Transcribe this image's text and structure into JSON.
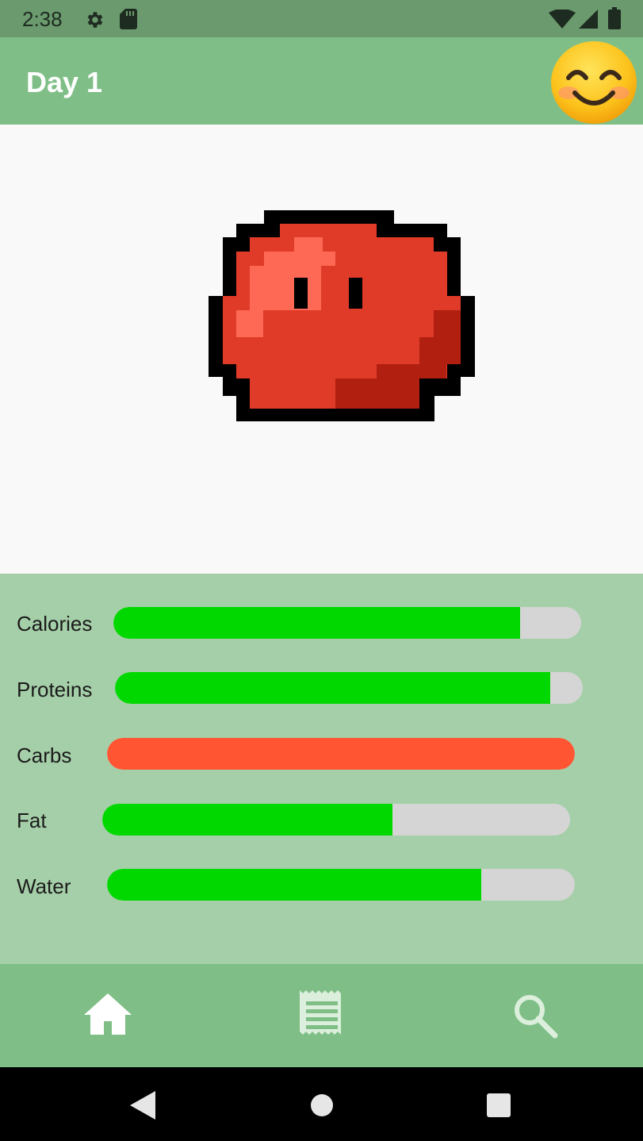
{
  "status_bar": {
    "time": "2:38",
    "icons": [
      "gear-icon",
      "sd-card-icon",
      "wifi-icon",
      "signal-icon",
      "battery-icon"
    ]
  },
  "app_bar": {
    "title": "Day 1",
    "mood_icon": "smiling-face-emoji-icon"
  },
  "pet": {
    "icon": "red-slime-pixel-icon",
    "colors": {
      "outline": "#000000",
      "body": "#e03a28",
      "highlight": "#fe6955",
      "shadow": "#b01f10"
    }
  },
  "stats": [
    {
      "label": "Calories",
      "fraction": 0.87,
      "color": "#00d800"
    },
    {
      "label": "Proteins",
      "fraction": 0.93,
      "color": "#00d800"
    },
    {
      "label": "Carbs",
      "fraction": 1.0,
      "color": "#ff5533"
    },
    {
      "label": "Fat",
      "fraction": 0.62,
      "color": "#00d800"
    },
    {
      "label": "Water",
      "fraction": 0.8,
      "color": "#00d800"
    }
  ],
  "bottom_nav": {
    "items": [
      {
        "icon": "home-icon",
        "selected": true
      },
      {
        "icon": "receipt-icon",
        "selected": false
      },
      {
        "icon": "search-icon",
        "selected": false
      }
    ]
  },
  "system_nav": [
    "back-icon",
    "home-circle-icon",
    "recents-icon"
  ],
  "theme": {
    "status_bar": "#6a9a6e",
    "primary": "#7fbf87",
    "stats_panel": "#a5cfa8",
    "track": "#d5d5d5"
  }
}
